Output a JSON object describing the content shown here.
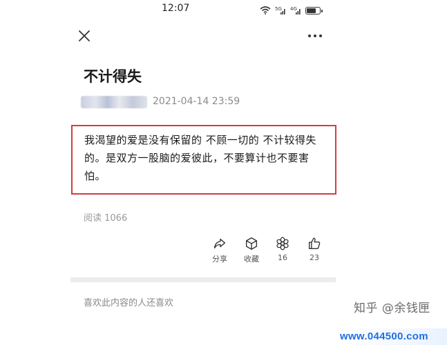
{
  "status_bar": {
    "time": "12:07",
    "signal_label_1": "5G",
    "signal_label_2": "4G",
    "battery_level": 0.8
  },
  "article": {
    "title": "不计得失",
    "date": "2021-04-14 23:59",
    "content": "我渴望的爱是没有保留的 不顾一切的 不计较得失的。是双方一股脑的爱彼此，不要算计也不要害怕。",
    "reads": "阅读 1066"
  },
  "actions": {
    "share_label": "分享",
    "collect_label": "收藏",
    "like_count": "16",
    "thumbs_count": "23"
  },
  "related": {
    "label": "喜欢此内容的人还喜欢"
  },
  "watermark": {
    "text": "知乎 @余钱匣",
    "site": "www.044500.com"
  },
  "colors": {
    "highlight_border": "#d63a3a",
    "site_blue": "#1f6fe0"
  }
}
